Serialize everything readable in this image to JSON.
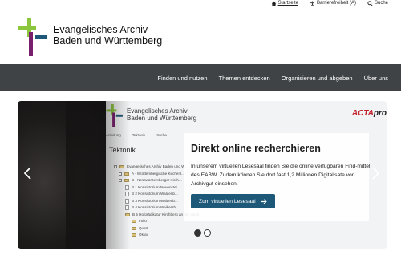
{
  "topbar": {
    "links": [
      {
        "label": "Startseite",
        "icon": "home-icon"
      },
      {
        "label": "Barrierefreiheit (A)",
        "icon": "accessibility-icon"
      },
      {
        "label": "Suche",
        "icon": "search-icon"
      }
    ]
  },
  "header": {
    "brand_line1": "Evangelisches Archiv",
    "brand_line2": "Baden und Württemberg",
    "logo_colors": {
      "green": "#8cc63f",
      "purple": "#7a1f6e",
      "blue": "#1d5878"
    }
  },
  "nav": {
    "items": [
      "Finden und nutzen",
      "Themen entdecken",
      "Organisieren und abgeben",
      "Über uns"
    ],
    "background": "#3f4346"
  },
  "hero": {
    "screenshot": {
      "brand_line1": "Evangelisches Archiv",
      "brand_line2": "Baden und Württemberg",
      "tabs": [
        "Anleitung",
        "Tektonik",
        "Suche"
      ],
      "acta_label_red": "ACTA",
      "acta_label": "pro",
      "title": "Tektonik",
      "tree": [
        "Evangelisches Archiv Baden und W...",
        "A - Württembergische Kirchenl...",
        "B - Nesswürttemberger Kirch...",
        "B 1 Konsistorium Neuenstei...",
        "B 2 Konsistorium Waldenb...",
        "B 3 Konsistorium Waldenb...",
        "B 4 Konsistorium Weikersh...",
        "B 5 Hofprädikatur Kirchberg an der Jagst",
        "Folio",
        "Quart",
        "Oktav"
      ]
    },
    "overlay": {
      "title": "Direkt online recherchieren",
      "text": "In unserem virtuellen Lesesaal finden Sie die online verfügbaren Find-mittel des EABW. Zudem können Sie dort fast 1,2 Millionen Digitalisate von Archivgut einsehen.",
      "button_label": "Zum virtuellen Lesesaal",
      "button_color": "#1d5878"
    },
    "carousel": {
      "slide_count": 2,
      "active_index": 0
    }
  }
}
